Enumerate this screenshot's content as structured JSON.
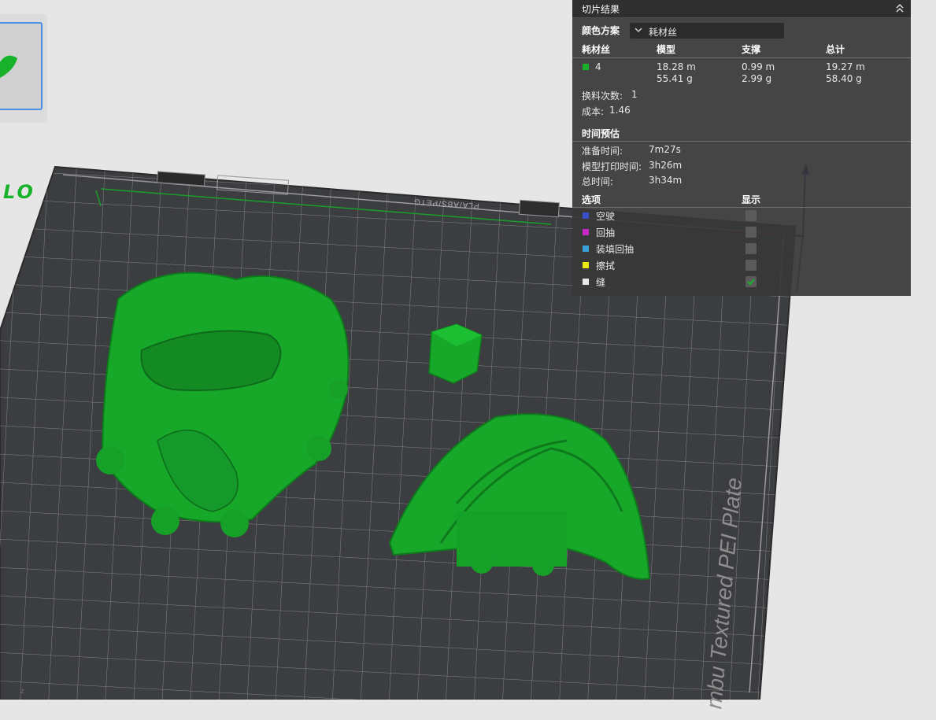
{
  "panel": {
    "title": "切片结果",
    "color_scheme_label": "颜色方案",
    "color_scheme_value": "耗材丝",
    "table": {
      "headers": [
        "耗材丝",
        "模型",
        "支撑",
        "总计"
      ],
      "rows": [
        {
          "filament": "4",
          "swatch_color": "#17b22a",
          "model_length": "18.28 m",
          "model_weight": "55.41 g",
          "support_length": "0.99 m",
          "support_weight": "2.99 g",
          "total_length": "19.27 m",
          "total_weight": "58.40 g"
        }
      ]
    },
    "change_count_label": "换料次数:",
    "change_count_value": "1",
    "cost_label": "成本:",
    "cost_value": "1.46",
    "time_title": "时间预估",
    "prep_time_label": "准备时间:",
    "prep_time_value": "7m27s",
    "print_time_label": "模型打印时间:",
    "print_time_value": "3h26m",
    "total_time_label": "总时间:",
    "total_time_value": "3h34m",
    "options_header": "选项",
    "display_header": "显示",
    "options": [
      {
        "label": "空驶",
        "color": "#3a4dc8",
        "checked": false
      },
      {
        "label": "回抽",
        "color": "#c828c8",
        "checked": false
      },
      {
        "label": "装填回抽",
        "color": "#3aa0d8",
        "checked": false
      },
      {
        "label": "擦拭",
        "color": "#e8e800",
        "checked": false
      },
      {
        "label": "缝",
        "color": "#e8e8e8",
        "checked": true
      }
    ]
  },
  "viewport": {
    "plate_text": "mbu Textured PEI Plate",
    "plate_top_label": "PLA/ABS/PETG",
    "side_logo": "LO",
    "axis_label": "z",
    "model_color": "#17b22a"
  }
}
